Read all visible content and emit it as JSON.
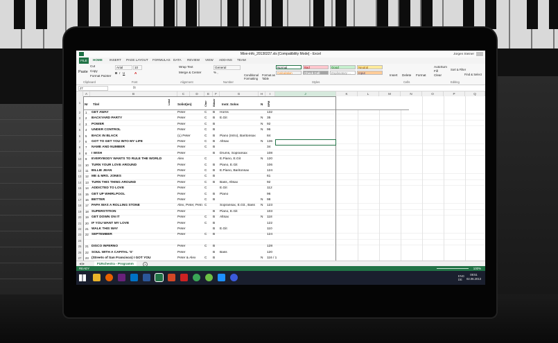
{
  "window": {
    "title": "Mixe-info_20130227.xls [Compatibility Mode] - Excel",
    "user": "Jürgen Steiner"
  },
  "ribbon_tabs": [
    "FILE",
    "HOME",
    "INSERT",
    "PAGE LAYOUT",
    "FORMULAS",
    "DATA",
    "REVIEW",
    "VIEW",
    "ADD-INS",
    "TEAM"
  ],
  "ribbon": {
    "cut": "Cut",
    "copy": "Copy",
    "format_painter": "Format Painter",
    "paste": "Paste",
    "font_name": "Arial",
    "font_size": "10",
    "wrap_text": "Wrap Text",
    "merge_center": "Merge & Center",
    "number_format": "General",
    "conditional_formatting": "Conditional Formatting",
    "format_as_table": "Format as Table",
    "styles": {
      "normal": "Normal",
      "bad": "Bad",
      "good": "Good",
      "neutral": "Neutral",
      "calculation": "Calculation",
      "check_cell": "Check Cell",
      "explanatory": "Explanatory ...",
      "input": "Input"
    },
    "insert": "Insert",
    "delete": "Delete",
    "format": "Format",
    "autosum": "AutoSum",
    "fill": "Fill",
    "clear": "Clear",
    "sort_filter": "Sort & Filter",
    "find_select": "Find & Select",
    "groups": {
      "clipboard": "Clipboard",
      "font": "Font",
      "alignment": "Alignment",
      "number": "Number",
      "styles": "Styles",
      "cells": "Cells",
      "editing": "Editing"
    }
  },
  "formula_bar": {
    "name_box": "J7",
    "fx": "fx"
  },
  "columns": [
    "A",
    "B",
    "C",
    "D",
    "E",
    "F",
    "G",
    "H",
    "I",
    "J",
    "K",
    "L",
    "M",
    "N",
    "O",
    "P",
    "Q"
  ],
  "table_headers": {
    "nr": "Nr",
    "title": "Titel",
    "lead": "Lead",
    "soloist": "Solist(en)",
    "choir": "Chor",
    "brass": "Bläser",
    "instr_solos": "Instr. Solos",
    "n": "N",
    "bpm": "BPM"
  },
  "rows": [
    {
      "rn": "2",
      "num": "1",
      "title": "GET AWAY",
      "soloist": "Peter",
      "c": "C",
      "b": "B",
      "instr": "Horns",
      "n": "",
      "val": "132"
    },
    {
      "rn": "3",
      "num": "2",
      "title": "BACKYARD PARTY",
      "soloist": "Peter",
      "c": "C",
      "b": "B",
      "instr": "E.Git",
      "n": "N",
      "val": "35"
    },
    {
      "rn": "4",
      "num": "3",
      "title": "POWER",
      "soloist": "Peter",
      "c": "C",
      "b": "B",
      "instr": "",
      "n": "N",
      "val": "92"
    },
    {
      "rn": "5",
      "num": "4",
      "title": "UNDER CONTROL",
      "soloist": "Peter",
      "c": "C",
      "b": "B",
      "instr": "",
      "n": "N",
      "val": "96"
    },
    {
      "rn": "6",
      "num": "5",
      "title": "BACK IN BLACK",
      "soloist": "(L) Peter",
      "c": "C",
      "b": "B",
      "instr": "Piano (Intro), Baritonsax",
      "n": "",
      "val": "84"
    },
    {
      "rn": "7",
      "num": "6",
      "title": "GOT TO GET YOU INTO MY LIFE",
      "soloist": "Peter",
      "c": "C",
      "b": "B",
      "instr": "Altsax",
      "n": "N",
      "val": "136"
    },
    {
      "rn": "8",
      "num": "7",
      "title": "NAME AND NUMBER",
      "soloist": "Peter",
      "c": "C",
      "b": "B",
      "instr": "",
      "n": "",
      "val": "34"
    },
    {
      "rn": "9",
      "num": "8",
      "title": "I WISH",
      "soloist": "Peter",
      "c": "",
      "b": "B",
      "instr": "Drums, Sopransax",
      "n": "",
      "val": "108"
    },
    {
      "rn": "10",
      "num": "9",
      "title": "EVERYBODY WANTS TO RULE THE WORLD",
      "soloist": "Alex",
      "c": "C",
      "b": "",
      "instr": "E.Piano, E.Git",
      "n": "N",
      "val": "120"
    },
    {
      "rn": "11",
      "num": "10",
      "title": "TURN YOUR LOVE AROUND",
      "soloist": "Peter",
      "c": "C",
      "b": "B",
      "instr": "Piano, E.Git",
      "n": "",
      "val": "106"
    },
    {
      "rn": "12",
      "num": "11",
      "title": "BILLIE JEAN",
      "soloist": "Peter",
      "c": "C",
      "b": "B",
      "instr": "E.Piano, Baritonsax",
      "n": "",
      "val": "124"
    },
    {
      "rn": "13",
      "num": "12",
      "title": "ME & MRS. JONES",
      "soloist": "Peter",
      "c": "C",
      "b": "B",
      "instr": "",
      "n": "",
      "val": "61"
    },
    {
      "rn": "14",
      "num": "13",
      "title": "TURN THIS THING AROUND",
      "soloist": "Peter",
      "c": "C",
      "b": "B",
      "instr": "Bass, Altsax",
      "n": "",
      "val": "92"
    },
    {
      "rn": "15",
      "num": "14",
      "title": "ADDICTED TO LOVE",
      "soloist": "Peter",
      "c": "C",
      "b": "",
      "instr": "E.Git",
      "n": "",
      "val": "112"
    },
    {
      "rn": "16",
      "num": "15",
      "title": "GET UP WHIRLPOOL",
      "soloist": "Peter",
      "c": "C",
      "b": "B",
      "instr": "Piano",
      "n": "",
      "val": "96"
    },
    {
      "rn": "17",
      "num": "16",
      "title": "BETTER",
      "soloist": "Peter",
      "c": "C",
      "b": "B",
      "instr": "",
      "n": "N",
      "val": "98"
    },
    {
      "rn": "18",
      "num": "17",
      "title": "PAPA WAS A ROLLING STONE",
      "soloist": "Alex, Peter, Petra",
      "c": "C",
      "b": "",
      "instr": "Sopransax, E.Git., Bass",
      "n": "N",
      "val": "123"
    },
    {
      "rn": "19",
      "num": "18",
      "title": "SUPERSTITION",
      "soloist": "Peter",
      "c": "",
      "b": "B",
      "instr": "Piano, E.Git",
      "n": "",
      "val": "103"
    },
    {
      "rn": "20",
      "num": "19",
      "title": "GET DOWN ON IT",
      "soloist": "Peter",
      "c": "C",
      "b": "B",
      "instr": "Altsax",
      "n": "N",
      "val": "118"
    },
    {
      "rn": "21",
      "num": "20",
      "title": "IF YOU WANT MY LOVE",
      "soloist": "Peter",
      "c": "C",
      "b": "B",
      "instr": "",
      "n": "",
      "val": "122"
    },
    {
      "rn": "22",
      "num": "21",
      "title": "WALK THIS WAY",
      "soloist": "Peter",
      "c": "",
      "b": "B",
      "instr": "E.Git",
      "n": "",
      "val": "110"
    },
    {
      "rn": "23",
      "num": "22",
      "title": "SEPTEMBER",
      "soloist": "Peter",
      "c": "C",
      "b": "B",
      "instr": "",
      "n": "",
      "val": "124"
    },
    {
      "rn": "24",
      "num": "",
      "title": "",
      "soloist": "",
      "c": "",
      "b": "",
      "instr": "",
      "n": "",
      "val": ""
    },
    {
      "rn": "25",
      "num": "21",
      "title": "DISCO INFERNO",
      "soloist": "Peter",
      "c": "C",
      "b": "B",
      "instr": "",
      "n": "",
      "val": "128"
    },
    {
      "rn": "26",
      "num": "22",
      "title": "SOUL WITH A CAPITAL 'S'",
      "soloist": "Peter",
      "c": "",
      "b": "B",
      "instr": "Bass",
      "n": "",
      "val": "120"
    },
    {
      "rn": "27",
      "num": "23",
      "title": "(Streets of San Francisco) I GOT YOU",
      "soloist": "Peter & Alex",
      "c": "C",
      "b": "B",
      "instr": "",
      "n": "N",
      "val": "116 / 142"
    }
  ],
  "sheet_tab": "FUNchestra - Programm",
  "status": {
    "ready": "READY",
    "zoom": "100%"
  },
  "taskbar": {
    "tray_lang": "ENG",
    "tray_region": "DE",
    "time": "08:51",
    "date": "02.06.2013"
  },
  "colors": {
    "excel_green": "#217346",
    "bad_fill": "#ffc7ce",
    "good_fill": "#c6efce",
    "neutral_fill": "#ffeb9c",
    "check_cell_fill": "#a5a5a5",
    "input_fill": "#ffcc99",
    "taskbar": "#1a1f2e"
  }
}
